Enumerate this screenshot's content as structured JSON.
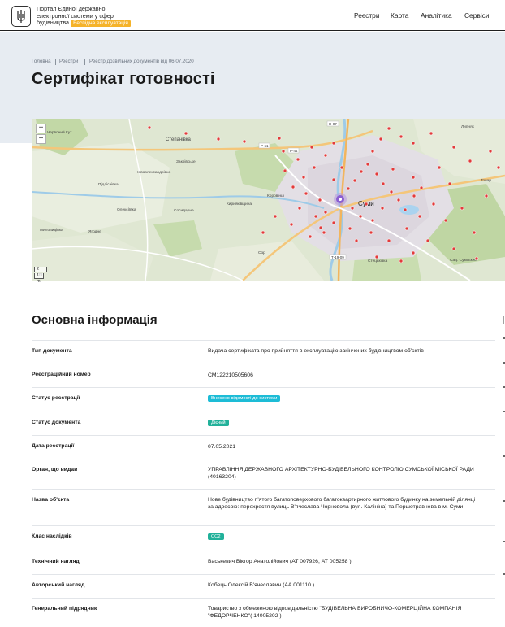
{
  "header": {
    "logo_line1": "Портал Єдиної державної",
    "logo_line2": "електронної системи у сфері",
    "logo_line3": "будівництва",
    "beta_label": "Бeспiдна експлуатація",
    "nav": [
      "Реєстри",
      "Карта",
      "Аналітика",
      "Сервіси"
    ]
  },
  "breadcrumb": [
    "Головна",
    "Реєстри",
    "Реєстр дозвільних документів від 06.07.2020"
  ],
  "page_title": "Сертифікат готовності",
  "map": {
    "zoom_in": "+",
    "zoom_out": "−",
    "scale_km": "2 km",
    "scale_mi": "1 mi",
    "places": [
      "Червоний Кут",
      "Степанівка",
      "Новоолександрівка",
      "Закрівське",
      "Підліснівка",
      "Олексіївка",
      "Сосидарне",
      "Миловидівка",
      "Ягодне",
      "Кирияківщина",
      "Коровінці",
      "Суми",
      "Липняк",
      "Товар",
      "Сор",
      "Стецьківка",
      "Сад. Сумський"
    ],
    "roads": [
      "Н-07",
      "Р-61",
      "Р-44",
      "Т-19-09"
    ]
  },
  "info": {
    "title": "Основна інформація",
    "side_letter": "І",
    "rows": [
      {
        "label": "Тип документа",
        "value": "Видача сертифіката про прийняття в експлуатацію закінчених будівництвом об'єктів"
      },
      {
        "label": "Реєстраційний номер",
        "value": "СМ122210505606"
      },
      {
        "label": "Статус реєстрації",
        "badge": "Внесено відомості до системи",
        "badge_color": "#1dbcd6"
      },
      {
        "label": "Статус документа",
        "badge": "Дієчий",
        "badge_color": "#21b19a"
      },
      {
        "label": "Дата реєстрації",
        "value": "07.05.2021"
      },
      {
        "label": "Орган, що видав",
        "value": "УПРАВЛІННЯ ДЕРЖАВНОГО АРХІТЕКТУРНО-БУДІВЕЛЬНОГО КОНТРОЛЮ СУМСЬКОЇ МІСЬКОЇ РАДИ (40163204)"
      },
      {
        "label": "Назва об'єкта",
        "value": "Нове будівництво п'ятого багатоповерхового багатоквартирного житлового будинку на земельній ділянці за адресою: перехрестя вулиць В'ячеслава Чорновола (вул. Калініна) та Першотравнева в м. Суми"
      },
      {
        "label": "Клас наслідків",
        "badge": "СС2",
        "badge_color": "#21b19a"
      },
      {
        "label": "Технічний нагляд",
        "value": "Васькевич Віктор Анатолійович (АТ 007926, АТ 005258 )"
      },
      {
        "label": "Авторський нагляд",
        "value": "Кобець Олексій В'ячеславич (АА 001110 )"
      },
      {
        "label": "Генеральний підрядник",
        "value": "Товариство з обмеженою відповідальністю \"БУДІВЕЛЬНА ВИРОБНИЧО-КОМЕРЦІЙНА КОМПАНІЯ \"ФЕДОРЧЕНКО\"( 14005202 )"
      }
    ]
  }
}
